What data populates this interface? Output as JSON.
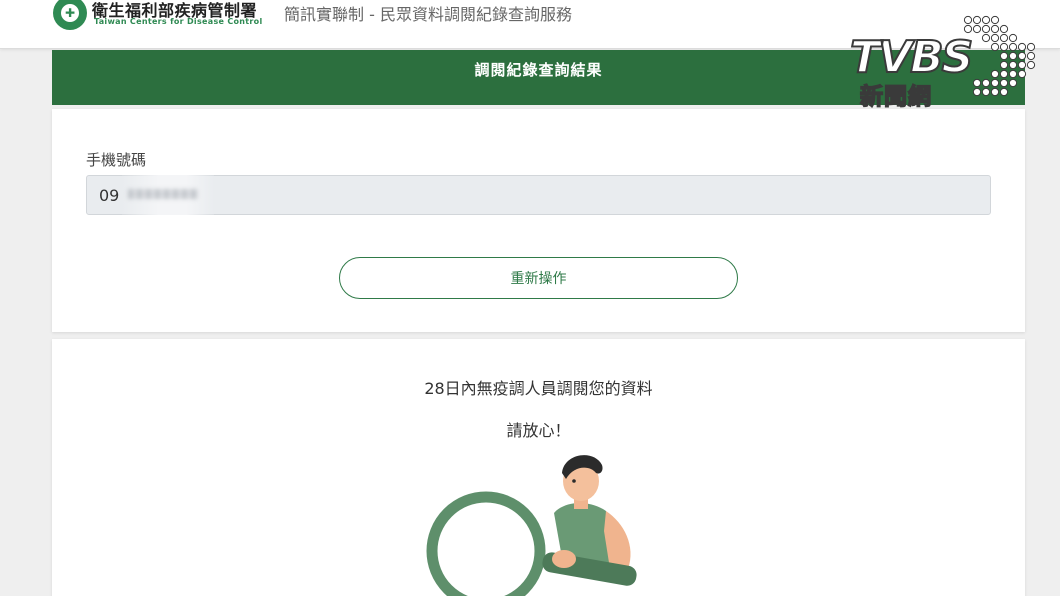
{
  "header": {
    "org_name": "衛生福利部疾病管制署",
    "org_name_en": "Taiwan Centers for Disease Control",
    "service_title": "簡訊實聯制 - 民眾資料調閱紀錄查詢服務",
    "logo_icon": "cdc-logo-icon"
  },
  "result_banner": {
    "title": "調閱紀錄查詢結果"
  },
  "phone": {
    "label": "手機號碼",
    "value_prefix": "09"
  },
  "actions": {
    "redo_label": "重新操作"
  },
  "result": {
    "message": "28日內無疫調人員調閱您的資料",
    "reassure": "請放心！"
  },
  "watermark": {
    "brand": "TVBS",
    "sub": "新聞網"
  },
  "colors": {
    "primary_green": "#2c6f3e",
    "button_green": "#2f7a48",
    "illustration_green": "#5e8f6b"
  }
}
